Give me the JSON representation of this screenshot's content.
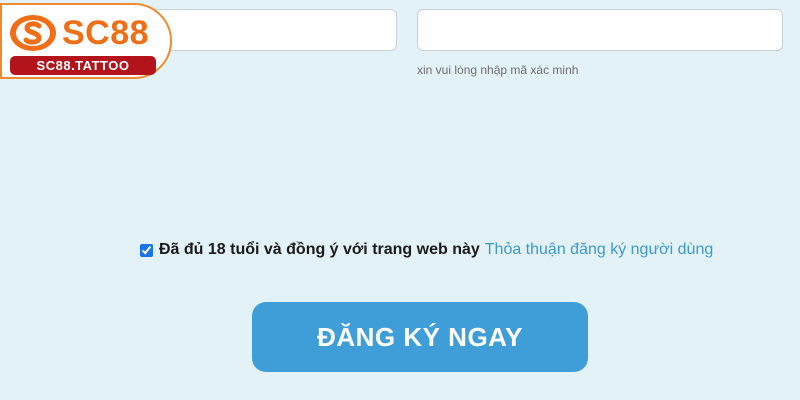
{
  "logo": {
    "wordmark": "SC88",
    "badge": "SC88.TATTOO",
    "icon": "s-coin-icon",
    "colors": {
      "orange": "#f06e16",
      "red": "#b3141c",
      "border": "#f08a2c"
    }
  },
  "form": {
    "field_left": {
      "value": "",
      "placeholder": ""
    },
    "field_right": {
      "value": "",
      "placeholder": ""
    },
    "captcha_hint": "xin vui lòng nhập mã xác minh"
  },
  "agreement": {
    "checked": true,
    "text": "Đã đủ 18 tuổi và đồng ý với trang web này",
    "link": "Thỏa thuận đăng ký người dùng"
  },
  "submit": {
    "label": "ĐĂNG KÝ NGAY",
    "color": "#3f9ed8"
  },
  "colors": {
    "background": "#e3f2f7",
    "link": "#3c99cf"
  }
}
